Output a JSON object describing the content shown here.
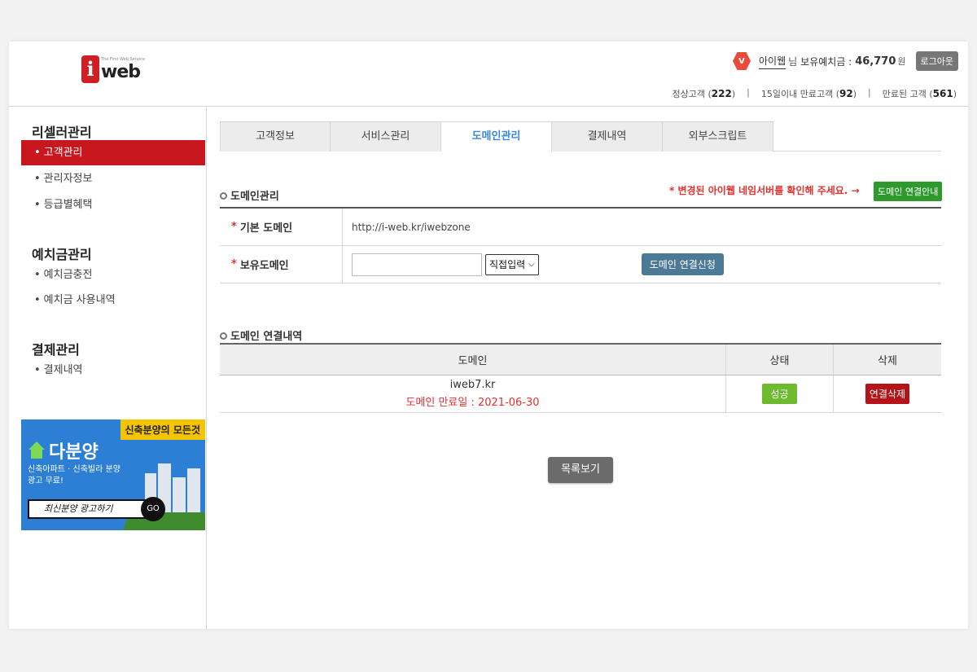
{
  "header": {
    "logo_letter": "i",
    "logo_text": "web",
    "logo_tagline": "The First Web Service",
    "level_badge": "V",
    "user_name": "아이웹",
    "user_suffix": "님",
    "balance_label": "보유예치금 :",
    "balance_value": "46,770",
    "balance_unit": "원",
    "logout_label": "로그아웃",
    "stats": [
      {
        "label": "정상고객",
        "count": "222"
      },
      {
        "label": "15일이내 만료고객",
        "count": "92"
      },
      {
        "label": "만료된 고객",
        "count": "561"
      }
    ]
  },
  "sidebar": {
    "groups": [
      {
        "title": "리셀러관리",
        "items": [
          "고객관리",
          "관리자정보",
          "등급별혜택"
        ]
      },
      {
        "title": "예치금관리",
        "items": [
          "예치금충전",
          "예치금 사용내역"
        ]
      },
      {
        "title": "결제관리",
        "items": [
          "결제내역"
        ]
      }
    ],
    "active_item": "고객관리",
    "banner": {
      "tag": "신축분양의 모든것",
      "title": "다분양",
      "subtitle": "신축아파트 · 신축빌라 분양광고 무료!",
      "button": "최신분양 광고하기",
      "go": "GO"
    }
  },
  "tabs": [
    "고객정보",
    "서비스관리",
    "도메인관리",
    "결제내역",
    "외부스크립트"
  ],
  "active_tab": "도메인관리",
  "domain_section": {
    "title": "도메인관리",
    "notice": "* 변경된 아이웹 네임서버를 확인해 주세요. →",
    "notice_button": "도메인 연결안내",
    "rows": [
      {
        "label": "기본 도메인",
        "value": "http://i-web.kr/iwebzone"
      },
      {
        "label": "보유도메인",
        "input_value": "",
        "select_value": "직접입력",
        "button": "도메인 연결신청"
      }
    ]
  },
  "history_section": {
    "title": "도메인 연결내역",
    "columns": [
      "도메인",
      "상태",
      "삭제"
    ],
    "rows": [
      {
        "domain": "iweb7.kr",
        "expiry": "도메인 만료일 : 2021-06-30",
        "status": "성공",
        "action": "연결삭제"
      }
    ]
  },
  "list_button": "목록보기",
  "colors": {
    "brand_red": "#c8171f",
    "accent_blue": "#3a8ad8",
    "success_green": "#6dbb2c",
    "notice_red": "#e53030"
  }
}
